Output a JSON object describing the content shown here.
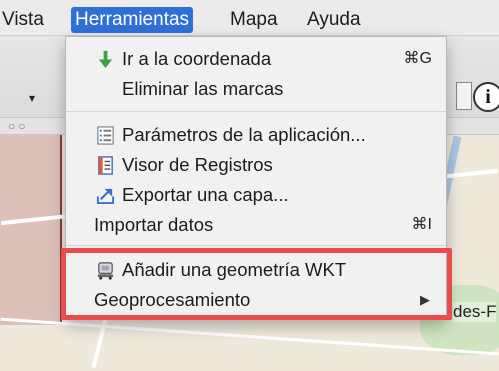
{
  "menubar": {
    "items": [
      "Vista",
      "Herramientas",
      "Mapa",
      "Ayuda"
    ],
    "active_index": 1
  },
  "menu": {
    "items": [
      {
        "label": "Ir a la coordenada",
        "shortcut": "⌘G",
        "icon": "arrow-down-icon"
      },
      {
        "label": "Eliminar las marcas",
        "shortcut": "",
        "icon": ""
      },
      {
        "label": "Parámetros de la aplicación...",
        "shortcut": "",
        "icon": "settings-list-icon"
      },
      {
        "label": "Visor de Registros",
        "shortcut": "",
        "icon": "log-viewer-icon"
      },
      {
        "label": "Exportar una capa...",
        "shortcut": "",
        "icon": "export-icon"
      },
      {
        "label": "Importar datos",
        "shortcut": "⌘I",
        "icon": ""
      },
      {
        "label": "Añadir una geometría WKT",
        "shortcut": "",
        "icon": "geometry-icon"
      },
      {
        "label": "Geoprocesamiento",
        "submenu_arrow": "▶",
        "icon": ""
      }
    ]
  },
  "map": {
    "partial_label": "des-F"
  },
  "toolbar": {
    "info_glyph": "i",
    "dropdown_arrow": "▾",
    "window_dots": "○○"
  },
  "colors": {
    "menu_highlight": "#2f6fd8",
    "annotation_box": "#ec4b4b"
  }
}
